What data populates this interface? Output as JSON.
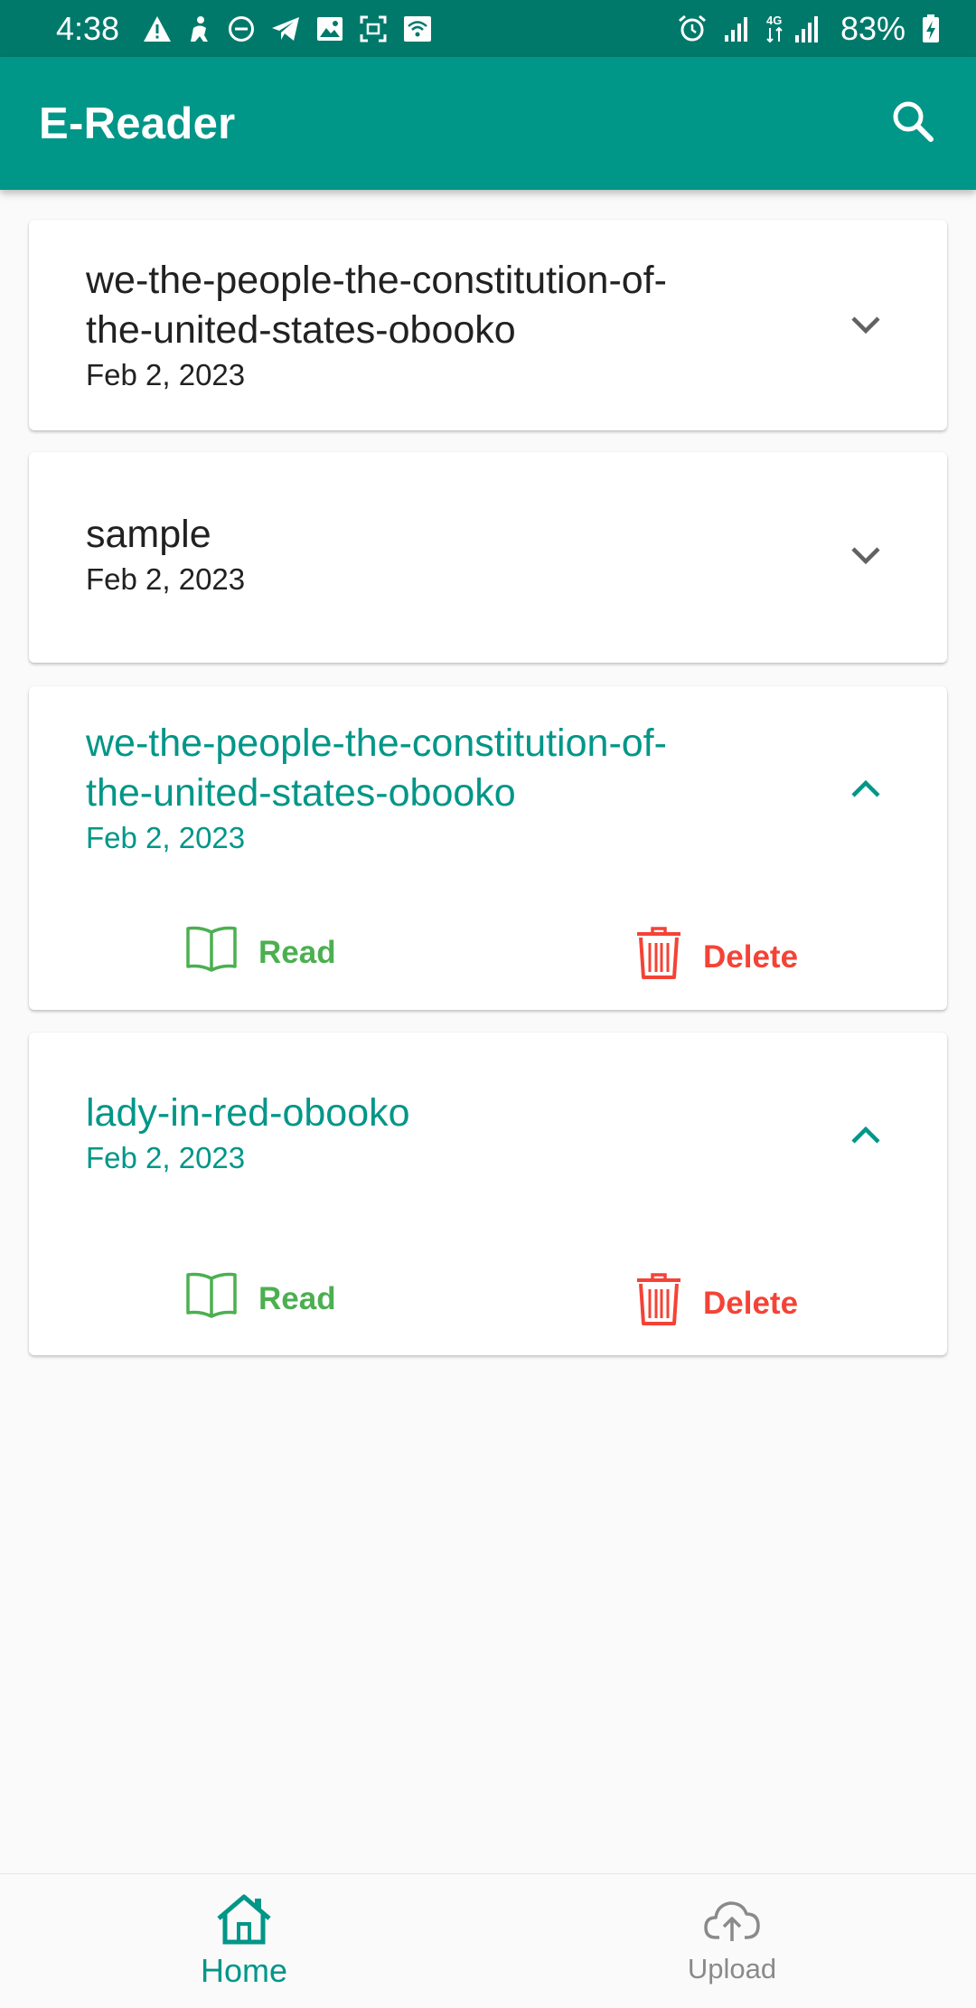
{
  "status_bar": {
    "time": "4:38",
    "battery": "83%",
    "network": "4G",
    "icons_left": [
      "warning-icon",
      "person-icon",
      "do-not-disturb-icon",
      "telegram-icon",
      "image-icon",
      "screenshot-icon",
      "wifi-box-icon"
    ],
    "icons_right": [
      "alarm-icon",
      "signal-icon",
      "signal-4g-icon",
      "battery-icon"
    ]
  },
  "app_bar": {
    "title": "E-Reader",
    "search_icon": "search-icon"
  },
  "books": [
    {
      "title_line1": "we-the-people-the-constitution-of-",
      "title_line2": "the-united-states-obooko",
      "date": "Feb 2, 2023",
      "expanded": false
    },
    {
      "title_line1": "sample",
      "date": "Feb 2, 2023",
      "expanded": false
    },
    {
      "title_line1": "we-the-people-the-constitution-of-",
      "title_line2": "the-united-states-obooko",
      "date": "Feb 2, 2023",
      "expanded": true,
      "read_label": "Read",
      "delete_label": "Delete"
    },
    {
      "title_line1": "lady-in-red-obooko",
      "date": "Feb 2, 2023",
      "expanded": true,
      "read_label": "Read",
      "delete_label": "Delete"
    }
  ],
  "bottom_nav": {
    "home_label": "Home",
    "upload_label": "Upload",
    "active": "Home"
  },
  "colors": {
    "status_bar": "#00796B",
    "primary": "#009688",
    "read": "#4CAF50",
    "delete": "#F44336",
    "nav_inactive": "#8A8A8A"
  }
}
